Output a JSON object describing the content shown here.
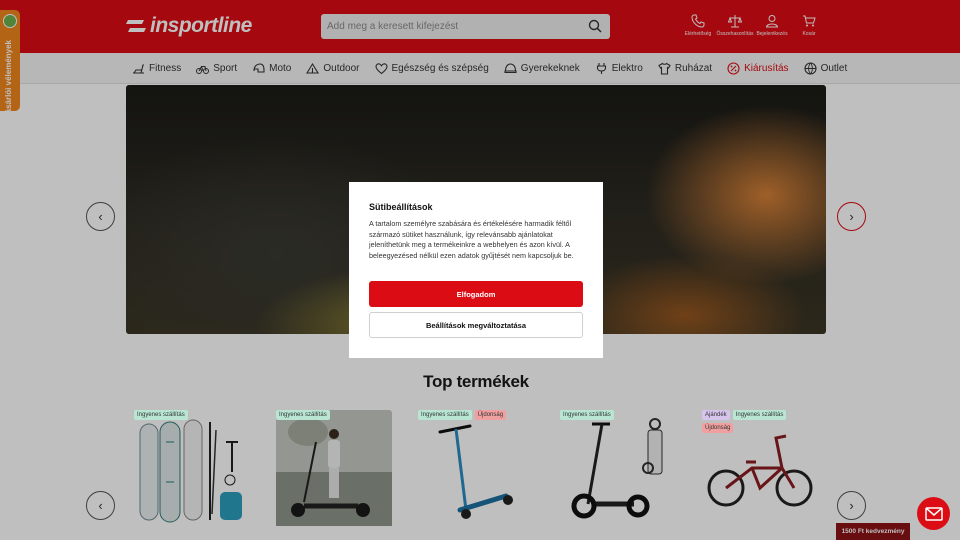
{
  "header": {
    "logo_text": "insportline",
    "search_placeholder": "Add meg a keresett kifejezést",
    "icons": [
      {
        "label": "Elérhetőség",
        "icon": "phone-icon"
      },
      {
        "label": "Összehasonlítás",
        "icon": "scales-icon"
      },
      {
        "label": "Bejelentkezés",
        "icon": "user-icon"
      },
      {
        "label": "Kosár",
        "icon": "cart-icon"
      }
    ],
    "bg_color": "#dc0c14"
  },
  "nav": {
    "items": [
      {
        "label": "Fitness",
        "icon": "treadmill-icon"
      },
      {
        "label": "Sport",
        "icon": "bicycle-icon"
      },
      {
        "label": "Moto",
        "icon": "helmet-icon"
      },
      {
        "label": "Outdoor",
        "icon": "tent-icon"
      },
      {
        "label": "Egészség és szépség",
        "icon": "heart-icon"
      },
      {
        "label": "Gyerekeknek",
        "icon": "cap-icon"
      },
      {
        "label": "Elektro",
        "icon": "plug-icon"
      },
      {
        "label": "Ruházat",
        "icon": "tshirt-icon"
      },
      {
        "label": "Kiárusítás",
        "icon": "percent-icon"
      },
      {
        "label": "Outlet",
        "icon": "ball-icon"
      }
    ]
  },
  "carousel": {
    "prev": "‹",
    "next": "›"
  },
  "products": {
    "title": "Top termékek",
    "cards": [
      {
        "badges": [
          {
            "text": "Ingyenes szállítás",
            "kind": "green"
          }
        ],
        "image": "paddleboard-set"
      },
      {
        "badges": [
          {
            "text": "Ingyenes szállítás",
            "kind": "green"
          }
        ],
        "image": "scooter-photo"
      },
      {
        "badges": [
          {
            "text": "Ingyenes szállítás",
            "kind": "green"
          },
          {
            "text": "Újdonság",
            "kind": "red"
          }
        ],
        "image": "stunt-scooter"
      },
      {
        "badges": [
          {
            "text": "Ingyenes szállítás",
            "kind": "green"
          }
        ],
        "image": "e-scooter"
      },
      {
        "badges": [
          {
            "text": "Ajándék",
            "kind": "purple"
          },
          {
            "text": "Ingyenes szállítás",
            "kind": "green"
          },
          {
            "text": "Újdonság",
            "kind": "red"
          }
        ],
        "image": "bmx-bike"
      }
    ]
  },
  "side_tab": {
    "label": "Vásárlói vélemények"
  },
  "discount_label": "1500 Ft kedvezmény",
  "cookie_modal": {
    "title": "Sütibeállítások",
    "text": "A tartalom személyre szabására és értékelésére harmadik féltől származó sütiket használunk, így relevánsabb ajánlatokat jeleníthetünk meg a termékeinkre a webhelyen és azon kívül. A beleegyezésed nélkül ezen adatok gyűjtését nem kapcsoljuk be.",
    "accept_label": "Elfogadom",
    "settings_label": "Beállítások megváltoztatása"
  }
}
